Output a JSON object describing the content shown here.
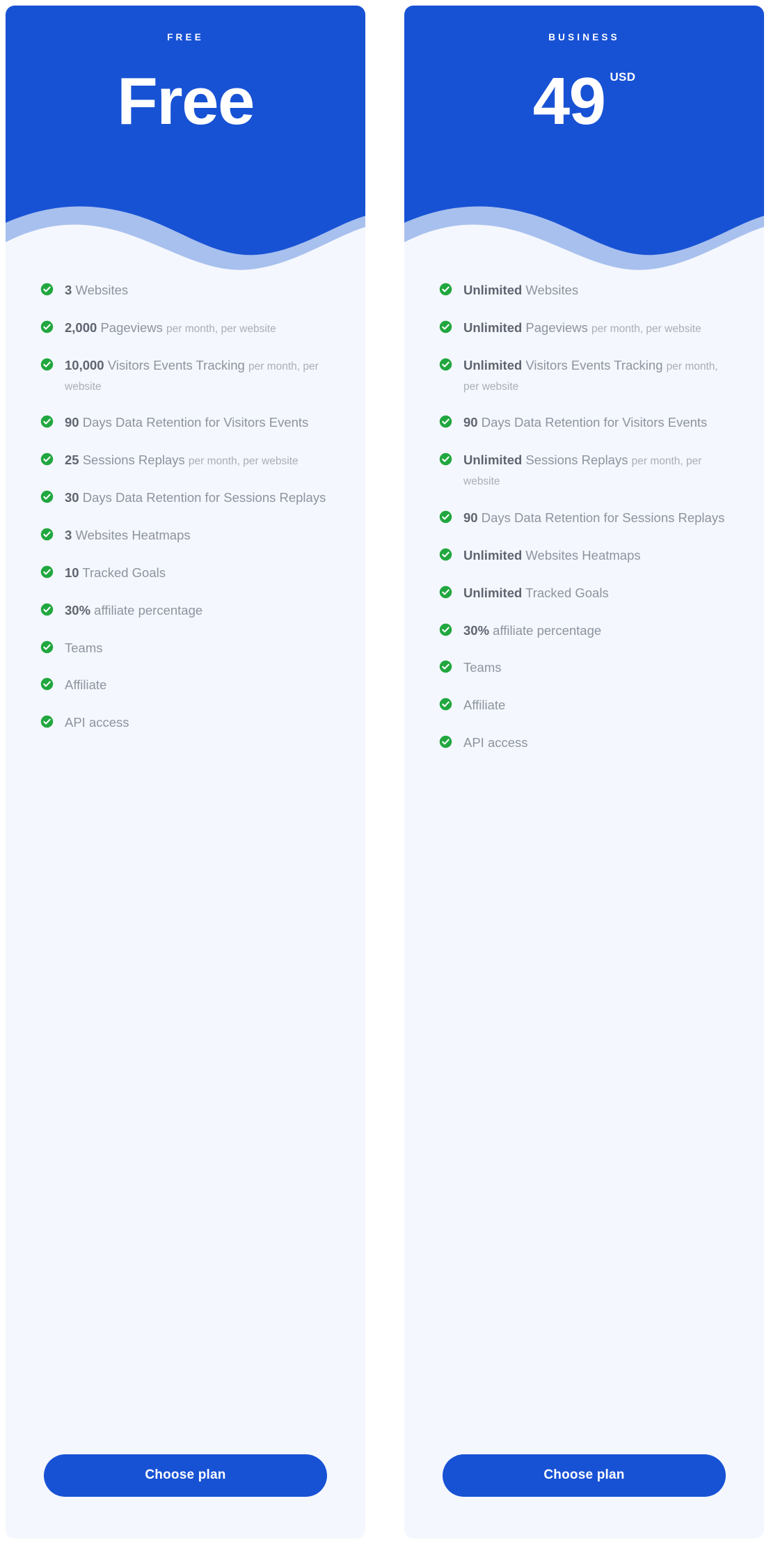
{
  "plans": [
    {
      "tag": "FREE",
      "price_amount": "Free",
      "price_currency": "",
      "show_currency": false,
      "cta_label": "Choose plan",
      "features": [
        {
          "value": "3",
          "label": "Websites",
          "sub": ""
        },
        {
          "value": "2,000",
          "label": "Pageviews",
          "sub": "per month, per website"
        },
        {
          "value": "10,000",
          "label": "Visitors Events Tracking",
          "sub": "per month, per website"
        },
        {
          "value": "90",
          "label": "Days Data Retention for Visitors Events",
          "sub": ""
        },
        {
          "value": "25",
          "label": "Sessions Replays",
          "sub": "per month, per website"
        },
        {
          "value": "30",
          "label": "Days Data Retention for Sessions Replays",
          "sub": ""
        },
        {
          "value": "3",
          "label": "Websites Heatmaps",
          "sub": ""
        },
        {
          "value": "10",
          "label": "Tracked Goals",
          "sub": ""
        },
        {
          "value": "30%",
          "label": "affiliate percentage",
          "sub": ""
        },
        {
          "value": "",
          "label": "Teams",
          "sub": ""
        },
        {
          "value": "",
          "label": "Affiliate",
          "sub": ""
        },
        {
          "value": "",
          "label": "API access",
          "sub": ""
        }
      ]
    },
    {
      "tag": "BUSINESS",
      "price_amount": "49",
      "price_currency": "USD",
      "show_currency": true,
      "cta_label": "Choose plan",
      "features": [
        {
          "value": "Unlimited",
          "label": "Websites",
          "sub": ""
        },
        {
          "value": "Unlimited",
          "label": "Pageviews",
          "sub": "per month, per website"
        },
        {
          "value": "Unlimited",
          "label": "Visitors Events Tracking",
          "sub": "per month, per website"
        },
        {
          "value": "90",
          "label": "Days Data Retention for Visitors Events",
          "sub": ""
        },
        {
          "value": "Unlimited",
          "label": "Sessions Replays",
          "sub": "per month, per website"
        },
        {
          "value": "90",
          "label": "Days Data Retention for Sessions Replays",
          "sub": ""
        },
        {
          "value": "Unlimited",
          "label": "Websites Heatmaps",
          "sub": ""
        },
        {
          "value": "Unlimited",
          "label": "Tracked Goals",
          "sub": ""
        },
        {
          "value": "30%",
          "label": "affiliate percentage",
          "sub": ""
        },
        {
          "value": "",
          "label": "Teams",
          "sub": ""
        },
        {
          "value": "",
          "label": "Affiliate",
          "sub": ""
        },
        {
          "value": "",
          "label": "API access",
          "sub": ""
        }
      ]
    }
  ],
  "icons": {
    "feature_check": "check-circle-icon"
  },
  "colors": {
    "brand_blue": "#1852d4",
    "card_body": "#f4f7fd",
    "wave_mid": "#a8c0ee",
    "check_green": "#21a73f",
    "value_text": "#5f6570",
    "label_text": "#8d949f",
    "sub_text": "#a9aeb8"
  }
}
